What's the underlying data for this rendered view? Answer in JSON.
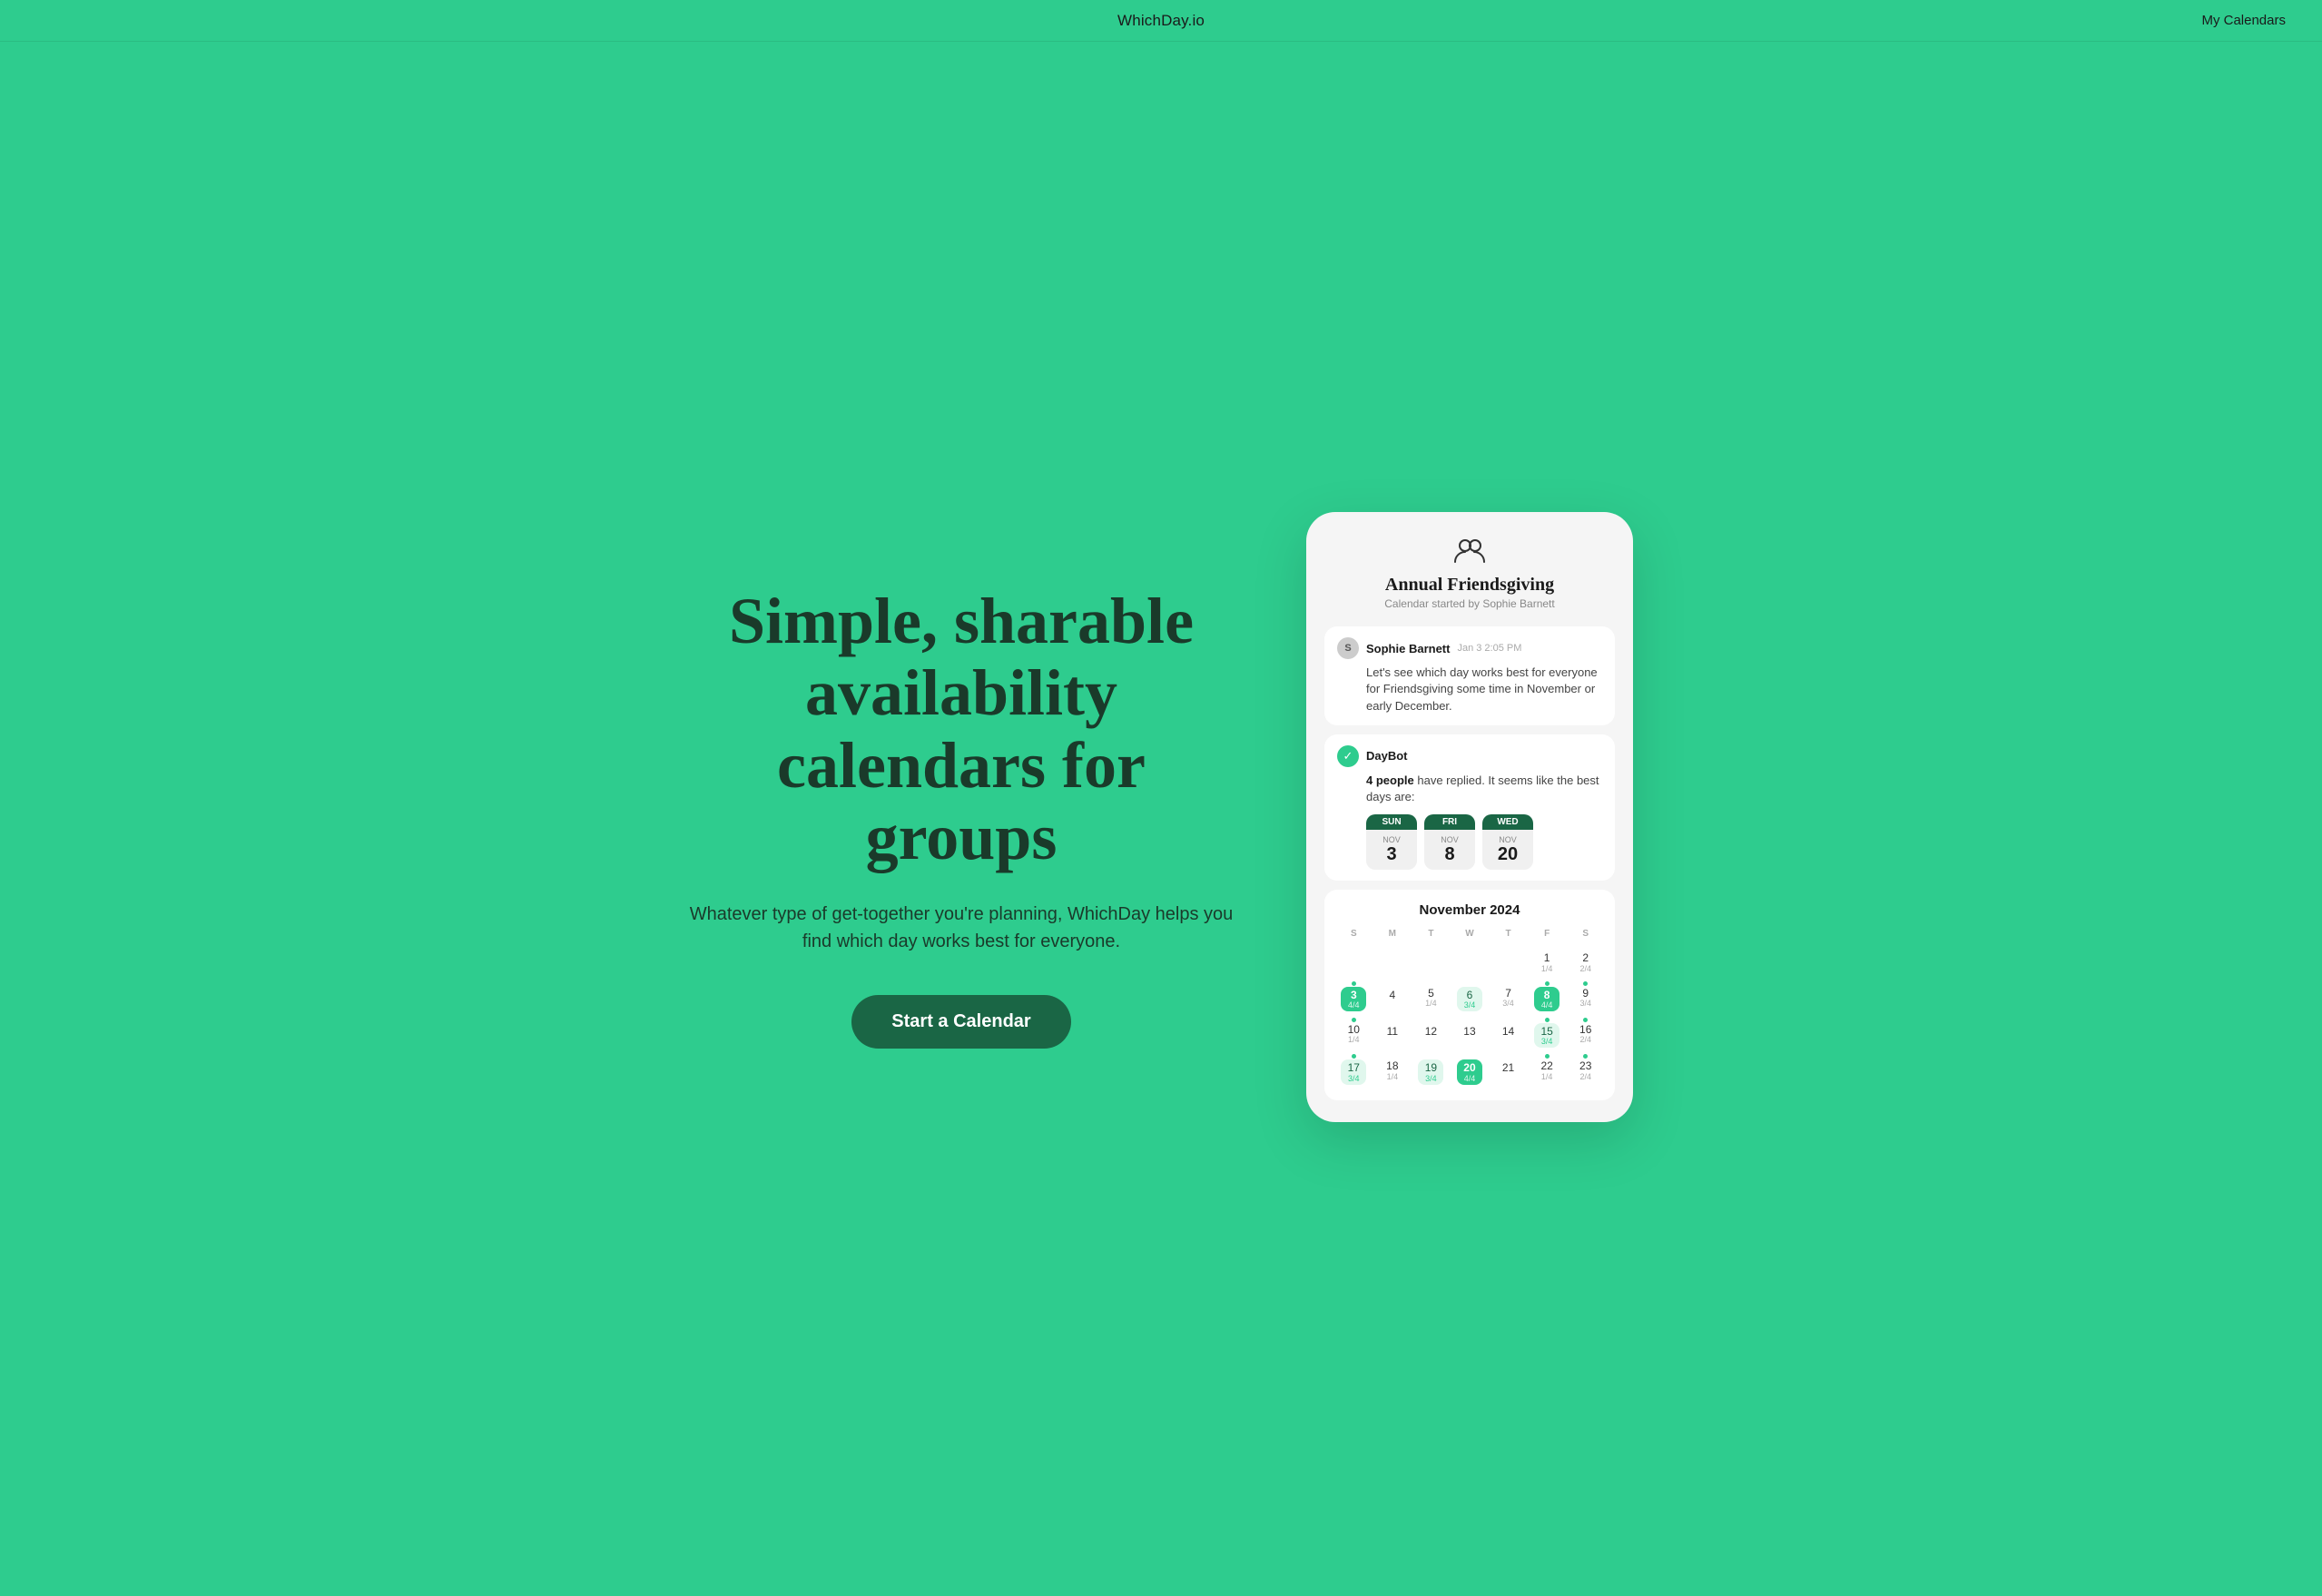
{
  "nav": {
    "logo": "WhichDay.io",
    "my_calendars": "My Calendars"
  },
  "hero": {
    "title": "Simple, sharable availability calendars for groups",
    "subtitle": "Whatever type of get-together you're planning, WhichDay helps you find which day works best for everyone.",
    "cta": "Start a Calendar"
  },
  "card": {
    "icon": "👥",
    "title": "Annual Friendsgiving",
    "subtitle": "Calendar started by Sophie Barnett",
    "message": {
      "sender": "Sophie Barnett",
      "time": "Jan 3 2:05 PM",
      "avatar_letter": "S",
      "text": "Let's see which day works best for everyone for Friendsgiving some time in November or early December."
    },
    "daybot": {
      "name": "DayBot",
      "intro": "4 people have replied. It seems like the best days are:",
      "best_days": [
        {
          "weekday": "SUN",
          "month": "NOV",
          "num": "3"
        },
        {
          "weekday": "FRI",
          "month": "NOV",
          "num": "8"
        },
        {
          "weekday": "WED",
          "month": "NOV",
          "num": "20"
        }
      ]
    },
    "calendar": {
      "title": "November 2024",
      "day_headers": [
        "S",
        "M",
        "T",
        "W",
        "T",
        "F",
        "S"
      ],
      "weeks": [
        [
          {
            "date": "",
            "frac": "",
            "type": "empty"
          },
          {
            "date": "",
            "frac": "",
            "type": "empty"
          },
          {
            "date": "",
            "frac": "",
            "type": "empty"
          },
          {
            "date": "",
            "frac": "",
            "type": "empty"
          },
          {
            "date": "",
            "frac": "",
            "type": "empty"
          },
          {
            "date": "1",
            "frac": "1/4",
            "type": "normal",
            "dot": false
          },
          {
            "date": "2",
            "frac": "2/4",
            "type": "normal",
            "dot": false
          }
        ],
        [
          {
            "date": "3",
            "frac": "4/4",
            "type": "highlighted",
            "dot": true
          },
          {
            "date": "4",
            "frac": "",
            "type": "normal",
            "dot": false
          },
          {
            "date": "5",
            "frac": "1/4",
            "type": "normal",
            "dot": false
          },
          {
            "date": "6",
            "frac": "3/4",
            "type": "light-highlight",
            "dot": false
          },
          {
            "date": "7",
            "frac": "3/4",
            "type": "normal",
            "dot": false
          },
          {
            "date": "8",
            "frac": "4/4",
            "type": "highlighted",
            "dot": true
          },
          {
            "date": "9",
            "frac": "3/4",
            "type": "normal",
            "dot": true
          }
        ],
        [
          {
            "date": "10",
            "frac": "1/4",
            "type": "normal",
            "dot": true
          },
          {
            "date": "11",
            "frac": "",
            "type": "normal",
            "dot": false
          },
          {
            "date": "12",
            "frac": "",
            "type": "normal",
            "dot": false
          },
          {
            "date": "13",
            "frac": "",
            "type": "normal",
            "dot": false
          },
          {
            "date": "14",
            "frac": "",
            "type": "normal",
            "dot": false
          },
          {
            "date": "15",
            "frac": "3/4",
            "type": "light-highlight",
            "dot": true
          },
          {
            "date": "16",
            "frac": "2/4",
            "type": "normal",
            "dot": true
          }
        ],
        [
          {
            "date": "17",
            "frac": "3/4",
            "type": "light-highlight",
            "dot": true
          },
          {
            "date": "18",
            "frac": "1/4",
            "type": "normal",
            "dot": false
          },
          {
            "date": "19",
            "frac": "3/4",
            "type": "light-highlight",
            "dot": false
          },
          {
            "date": "20",
            "frac": "4/4",
            "type": "highlighted",
            "dot": false
          },
          {
            "date": "21",
            "frac": "",
            "type": "normal",
            "dot": false
          },
          {
            "date": "22",
            "frac": "1/4",
            "type": "normal",
            "dot": true
          },
          {
            "date": "23",
            "frac": "2/4",
            "type": "normal",
            "dot": true
          }
        ]
      ]
    }
  }
}
